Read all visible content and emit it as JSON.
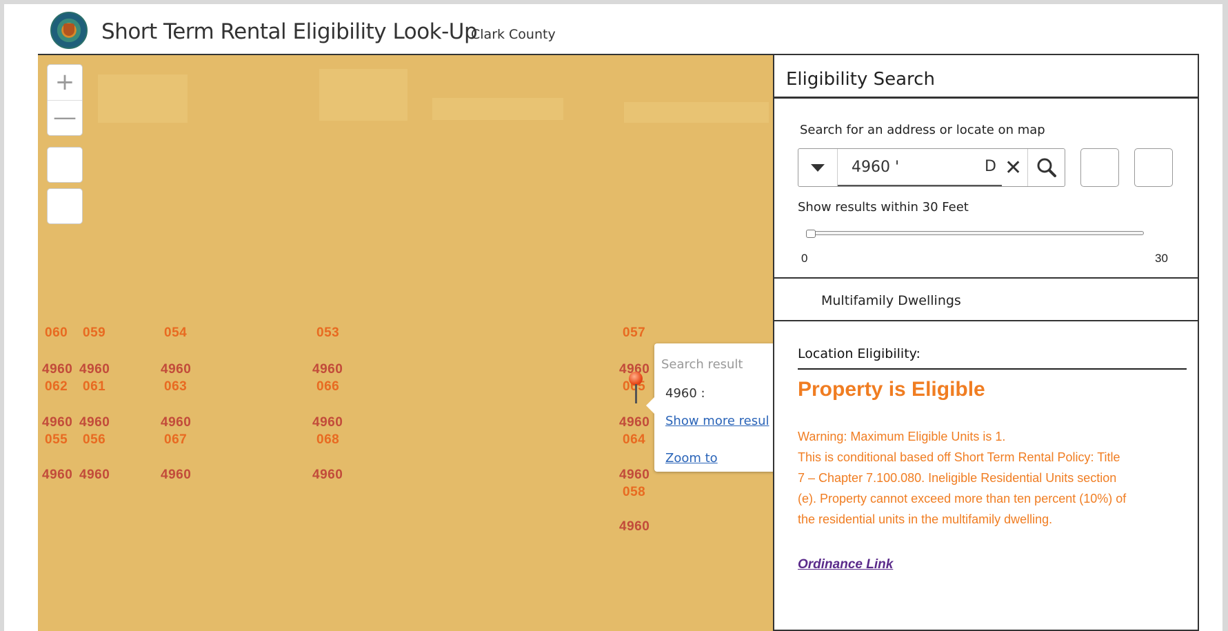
{
  "header": {
    "title": "Short Term Rental Eligibility Look-Up",
    "county": "Clark County",
    "logo_icon": "county-seal-logo"
  },
  "map": {
    "background_color": "#e4bb69",
    "zoom_in_label": "+",
    "zoom_out_label": "—",
    "unit_label_color": "#e86a21",
    "address_label_color": "#c24b3a",
    "parcel_labels": {
      "units": [
        "060",
        "059",
        "054",
        "053",
        "057",
        "062",
        "061",
        "063",
        "066",
        "065",
        "055",
        "056",
        "067",
        "068",
        "064",
        "058"
      ],
      "addresses": [
        "4960",
        "4960",
        "4960",
        "4960",
        "4960",
        "4960",
        "4960",
        "4960",
        "4960",
        "4960",
        "4960",
        "4960",
        "4960",
        "4960",
        "4960",
        "4960"
      ]
    },
    "popup": {
      "title": "Search result",
      "address": "4960 :",
      "show_more": "Show more resul",
      "zoom_to": "Zoom to"
    }
  },
  "panel": {
    "title": "Eligibility Search",
    "search_label": "Search for an address or locate on map",
    "search_value": "4960 '",
    "search_suffix": "D",
    "clear_icon": "✕",
    "within_label": "Show results within 30 Feet",
    "slider": {
      "min": "0",
      "max": "30",
      "value": 0
    },
    "layer_name": "Multifamily Dwellings",
    "location_label": "Location Eligibility:",
    "status": "Property is Eligible",
    "status_color": "#f07d22",
    "warning_lines": [
      "Warning: Maximum Eligible Units is 1.",
      "This is conditional based off Short Term Rental Policy: Title",
      "7 – Chapter 7.100.080. Ineligible Residential Units section",
      "(e). Property cannot exceed more than ten percent (10%) of",
      "the residential units in the multifamily dwelling."
    ],
    "ordinance_link": "Ordinance Link "
  }
}
